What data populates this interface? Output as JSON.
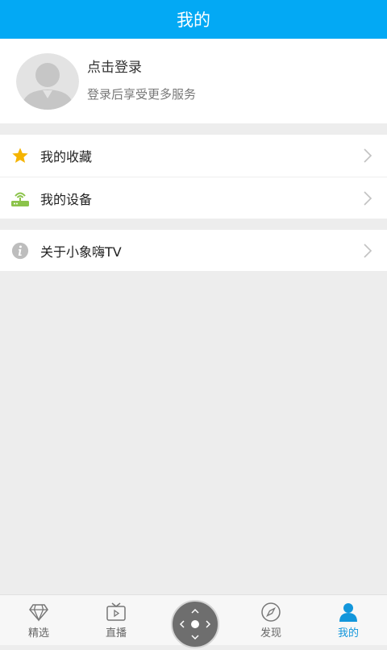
{
  "header": {
    "title": "我的"
  },
  "profile": {
    "login_title": "点击登录",
    "login_subtitle": "登录后享受更多服务"
  },
  "menu": {
    "favorites": {
      "label": "我的收藏",
      "icon": "star-icon"
    },
    "devices": {
      "label": "我的设备",
      "icon": "router-icon"
    },
    "about": {
      "label": "关于小象嗨TV",
      "icon": "info-icon"
    }
  },
  "tabs": [
    {
      "label": "精选",
      "icon": "diamond-icon"
    },
    {
      "label": "直播",
      "icon": "tv-icon"
    },
    {
      "label": "",
      "icon": "remote-control-icon"
    },
    {
      "label": "发现",
      "icon": "compass-icon"
    },
    {
      "label": "我的",
      "icon": "person-icon"
    }
  ],
  "colors": {
    "header_bg": "#03a9f4",
    "active_tab": "#1296db",
    "star": "#f5b400",
    "router": "#8bc34a",
    "info": "#bdbdbd"
  }
}
